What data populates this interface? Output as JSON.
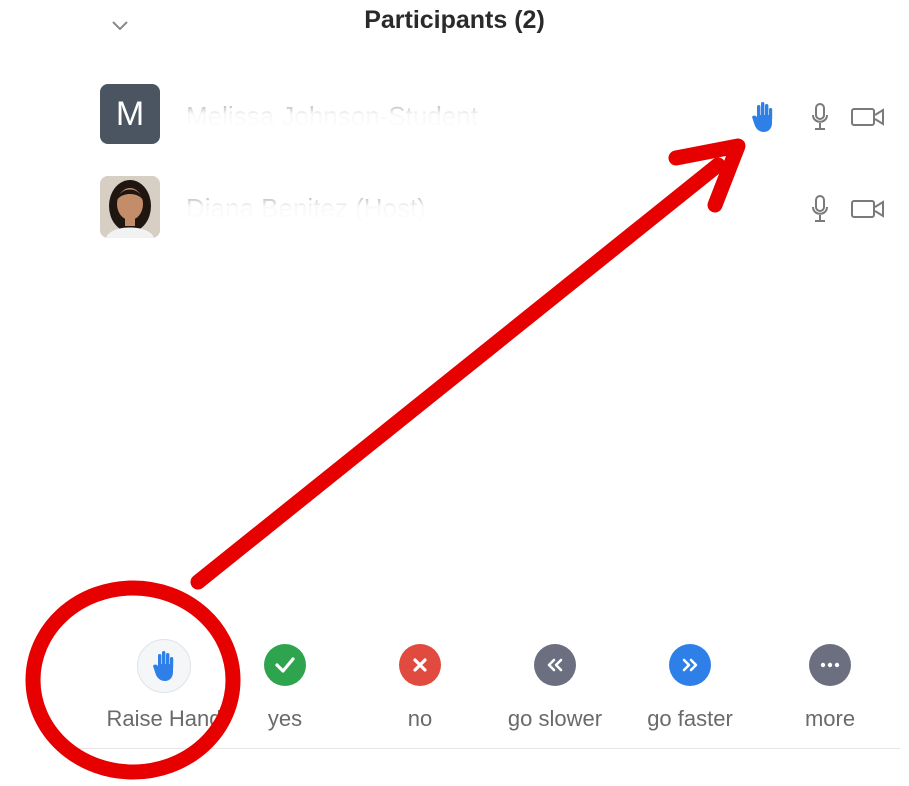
{
  "panel": {
    "title": "Participants (2)",
    "collapse_icon": "chevron-down-icon"
  },
  "participants": [
    {
      "avatar_letter": "M",
      "avatar_color": "#4a5561",
      "name": "Melissa Johnson-Student",
      "hand_raised": true
    },
    {
      "avatar_type": "photo",
      "name": "Diana Benitez (Host)",
      "hand_raised": false
    }
  ],
  "reactions": [
    {
      "label": "Raise Hand",
      "icon": "raised-hand-icon",
      "color": "#2f7fe8"
    },
    {
      "label": "yes",
      "icon": "check-icon",
      "color": "#2ea44f"
    },
    {
      "label": "no",
      "icon": "x-icon",
      "color": "#e04a3f"
    },
    {
      "label": "go slower",
      "icon": "rewind-icon",
      "color": "#6b6f80"
    },
    {
      "label": "go faster",
      "icon": "fast-forward-icon",
      "color": "#2f7fe8"
    },
    {
      "label": "more",
      "icon": "more-dots-icon",
      "color": "#6b6f80"
    }
  ],
  "annotation": {
    "color": "#e60000"
  }
}
